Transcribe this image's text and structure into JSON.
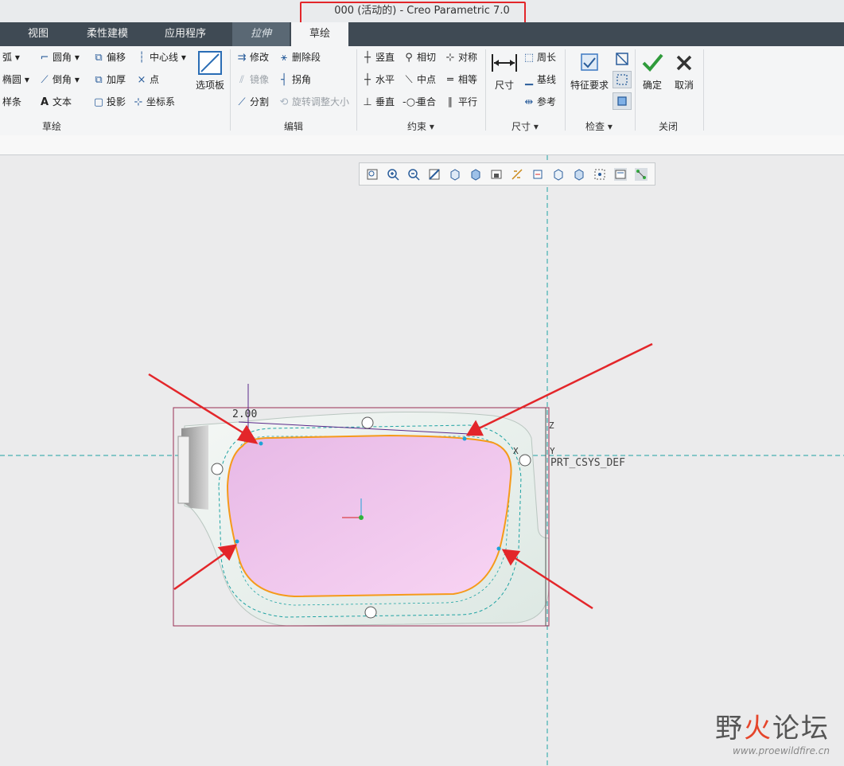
{
  "window": {
    "title": "000 (活动的) - Creo Parametric 7.0"
  },
  "tabs": [
    {
      "label": "视图"
    },
    {
      "label": "柔性建模"
    },
    {
      "label": "应用程序"
    },
    {
      "label": "拉伸"
    },
    {
      "label": "草绘"
    }
  ],
  "ribbon": {
    "sketch_group": {
      "label": "草绘",
      "items": [
        "弧",
        "圆角",
        "偏移",
        "中心线",
        "椭圆",
        "倒角",
        "加厚",
        "点",
        "样条",
        "文本",
        "投影",
        "坐标系"
      ],
      "palette": "选项板"
    },
    "edit_group": {
      "label": "编辑",
      "items": [
        "修改",
        "删除段",
        "镜像",
        "拐角",
        "分割",
        "旋转调整大小"
      ]
    },
    "constrain_group": {
      "label": "约束",
      "items": [
        "竖直",
        "相切",
        "对称",
        "水平",
        "中点",
        "相等",
        "垂直",
        "重合",
        "平行"
      ]
    },
    "dimension_group": {
      "label": "尺寸",
      "big": "尺寸",
      "items": [
        "周长",
        "基线",
        "参考"
      ]
    },
    "inspect_group": {
      "label": "检查",
      "big": "特征要求"
    },
    "close_group": {
      "label": "关闭",
      "ok": "确定",
      "cancel": "取消"
    }
  },
  "canvas": {
    "dimension_text": "2.00",
    "csys_label": "PRT_CSYS_DEF",
    "axis_x": "X",
    "axis_y": "Y",
    "axis_z": "Z"
  },
  "watermark": {
    "brand_a": "野",
    "brand_b": "火",
    "brand_c": "论坛",
    "url": "www.proewildfire.cn"
  },
  "colors": {
    "ribbon_dark": "#3f4a54",
    "sketch_curve": "#f59a1a",
    "fill": "#f1c8f0",
    "annotation_arrow": "#e3262a",
    "centerline": "#1fa3a3"
  }
}
